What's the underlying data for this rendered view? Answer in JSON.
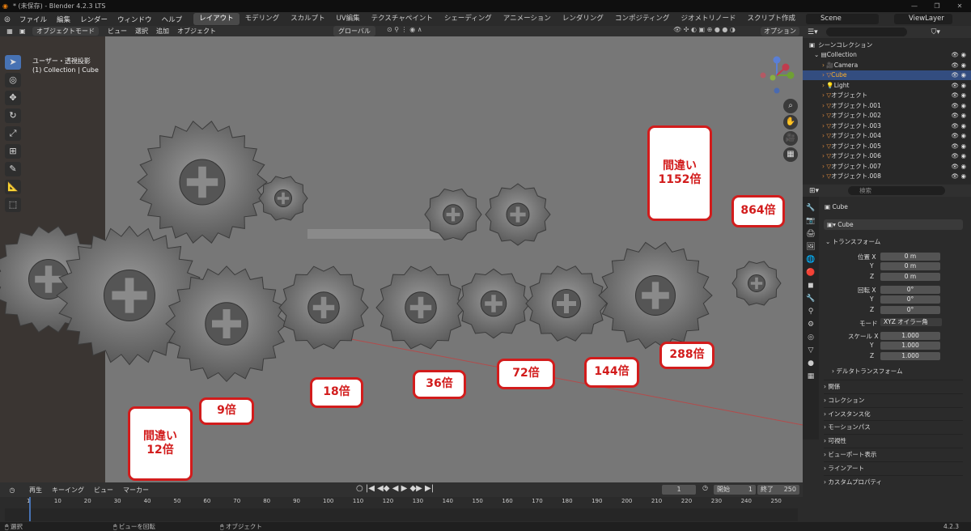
{
  "window": {
    "title": "* (未保存) - Blender 4.2.3 LTS",
    "controls": [
      "—",
      "❐",
      "✕"
    ]
  },
  "menu": {
    "items": [
      "ファイル",
      "編集",
      "レンダー",
      "ウィンドウ",
      "ヘルプ"
    ],
    "workspaces": [
      "レイアウト",
      "モデリング",
      "スカルプト",
      "UV編集",
      "テクスチャペイント",
      "シェーディング",
      "アニメーション",
      "レンダリング",
      "コンポジティング",
      "ジオメトリノード",
      "スクリプト作成"
    ],
    "add_tab": "+",
    "scene": "Scene",
    "view_layer": "ViewLayer"
  },
  "viewport_header": {
    "mode": "オブジェクトモード",
    "items": [
      "ビュー",
      "選択",
      "追加",
      "オブジェクト"
    ],
    "transform": "グローバル",
    "options": "オプション"
  },
  "viewport": {
    "view_label": "ユーザー・透視投影",
    "collection_label": "(1) Collection | Cube"
  },
  "callouts": {
    "c1152": "間違い\n1152倍",
    "c864": "864倍",
    "c9": "9倍",
    "c12": "間違い\n12倍",
    "c18": "18倍",
    "c36": "36倍",
    "c72": "72倍",
    "c144": "144倍",
    "c288": "288倍"
  },
  "outliner": {
    "header": "シーンコレクション",
    "rows": [
      {
        "name": "Collection",
        "type": "collection"
      },
      {
        "name": "Camera",
        "type": "camera"
      },
      {
        "name": "Cube",
        "type": "mesh",
        "selected": true
      },
      {
        "name": "Light",
        "type": "light"
      },
      {
        "name": "オブジェクト",
        "type": "mesh"
      },
      {
        "name": "オブジェクト.001",
        "type": "mesh"
      },
      {
        "name": "オブジェクト.002",
        "type": "mesh"
      },
      {
        "name": "オブジェクト.003",
        "type": "mesh"
      },
      {
        "name": "オブジェクト.004",
        "type": "mesh"
      },
      {
        "name": "オブジェクト.005",
        "type": "mesh"
      },
      {
        "name": "オブジェクト.006",
        "type": "mesh"
      },
      {
        "name": "オブジェクト.007",
        "type": "mesh"
      },
      {
        "name": "オブジェクト.008",
        "type": "mesh"
      }
    ]
  },
  "properties": {
    "search_placeholder": "検索",
    "object_name": "Cube",
    "data_name": "Cube",
    "transform_header": "トランスフォーム",
    "location_label": "位置 X",
    "loc": [
      "0 m",
      "0 m",
      "0 m"
    ],
    "rotation_label": "回転 X",
    "rot": [
      "0°",
      "0°",
      "0°"
    ],
    "mode_label": "モード",
    "mode_value": "XYZ オイラー角",
    "scale_label": "スケール X",
    "scale": [
      "1.000",
      "1.000",
      "1.000"
    ],
    "axis_y": "Y",
    "axis_z": "Z",
    "delta": "デルタトランスフォーム",
    "panels": [
      "関係",
      "コレクション",
      "インスタンス化",
      "モーションパス",
      "可視性",
      "ビューポート表示",
      "ラインアート",
      "カスタムプロパティ"
    ]
  },
  "timeline": {
    "menus": [
      "再生",
      "キーイング",
      "ビュー",
      "マーカー"
    ],
    "current_frame": "1",
    "start_label": "開始",
    "start": "1",
    "end_label": "終了",
    "end": "250",
    "ticks": [
      "1",
      "10",
      "20",
      "30",
      "40",
      "50",
      "60",
      "70",
      "80",
      "90",
      "100",
      "110",
      "120",
      "130",
      "140",
      "150",
      "160",
      "170",
      "180",
      "190",
      "200",
      "210",
      "220",
      "230",
      "240",
      "250"
    ]
  },
  "status": {
    "select": "選択",
    "rotate": "ビューを回転",
    "object": "オブジェクト",
    "version": "4.2.3"
  },
  "colors": {
    "callout_border": "#d21c1c",
    "selection": "#334d80",
    "active_tab": "#4772b3"
  }
}
